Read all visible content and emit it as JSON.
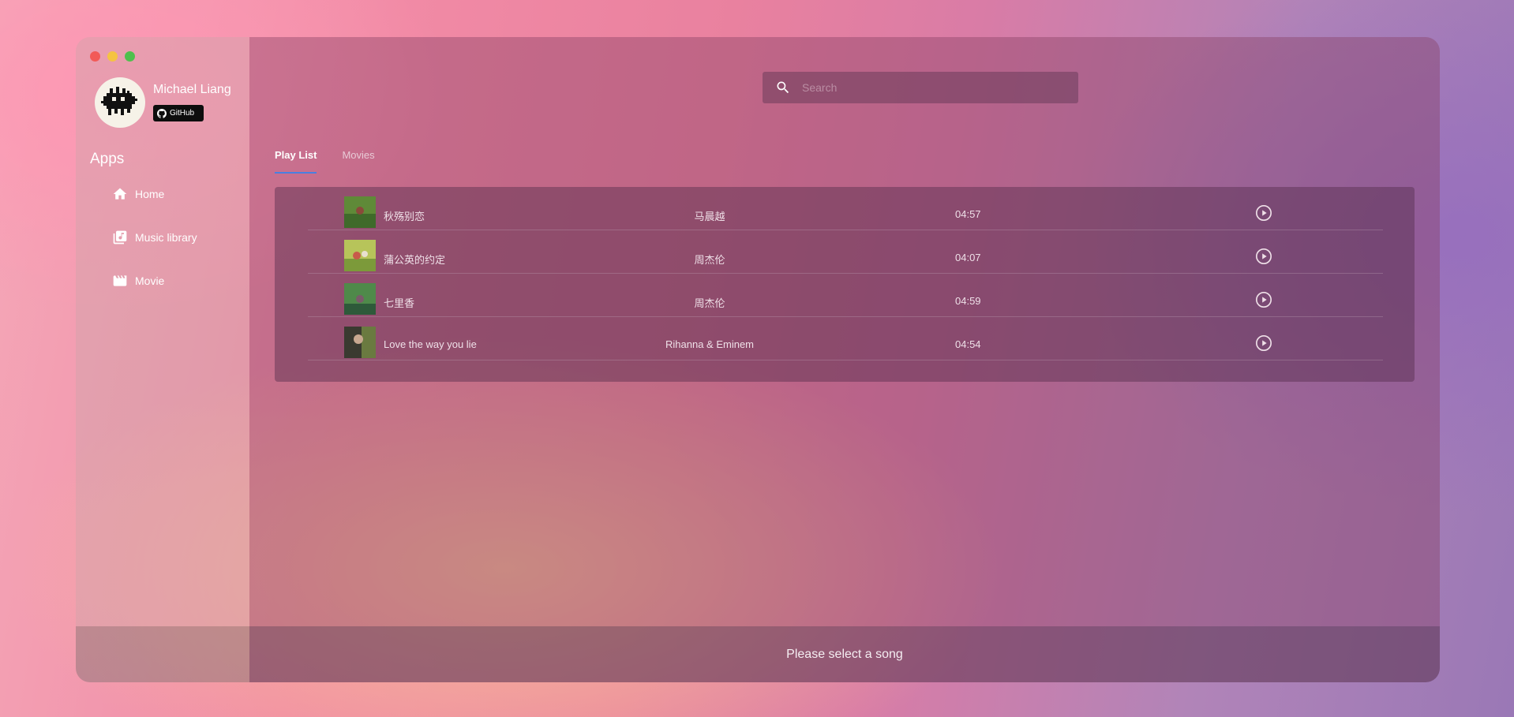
{
  "window_controls": [
    "close",
    "minimize",
    "maximize"
  ],
  "profile": {
    "name": "Michael Liang",
    "badge_label": "GitHub",
    "avatar_icon": "pixel-creature-avatar",
    "badge_icon": "github-icon"
  },
  "sidebar": {
    "section_title": "Apps",
    "items": [
      {
        "label": "Home",
        "icon": "home-icon"
      },
      {
        "label": "Music library",
        "icon": "music-library-icon"
      },
      {
        "label": "Movie",
        "icon": "movie-clapper-icon"
      }
    ]
  },
  "search": {
    "placeholder": "Search",
    "value": "",
    "icon": "search-icon"
  },
  "tabs": [
    {
      "label": "Play List",
      "active": true
    },
    {
      "label": "Movies",
      "active": false
    }
  ],
  "playlist": {
    "rows": [
      {
        "title": "秋殇别恋",
        "artist": "马晨越",
        "duration": "04:57",
        "thumb_colors": [
          "#6b8a3a",
          "#3f6a2a"
        ]
      },
      {
        "title": "蒲公英的约定",
        "artist": "周杰伦",
        "duration": "04:07",
        "thumb_colors": [
          "#b7c45a",
          "#7c9a3a"
        ]
      },
      {
        "title": "七里香",
        "artist": "周杰伦",
        "duration": "04:59",
        "thumb_colors": [
          "#4f8a4a",
          "#2e5a3a"
        ]
      },
      {
        "title": "Love the way you lie",
        "artist": "Rihanna & Eminem",
        "duration": "04:54",
        "thumb_colors": [
          "#3a3a30",
          "#6a7a40"
        ]
      }
    ]
  },
  "footer": {
    "status_text": "Please select a song"
  },
  "colors": {
    "tab_accent": "#4a7fe0",
    "close": "#f25a57",
    "minimize": "#f5c342",
    "maximize": "#4ec04d"
  }
}
